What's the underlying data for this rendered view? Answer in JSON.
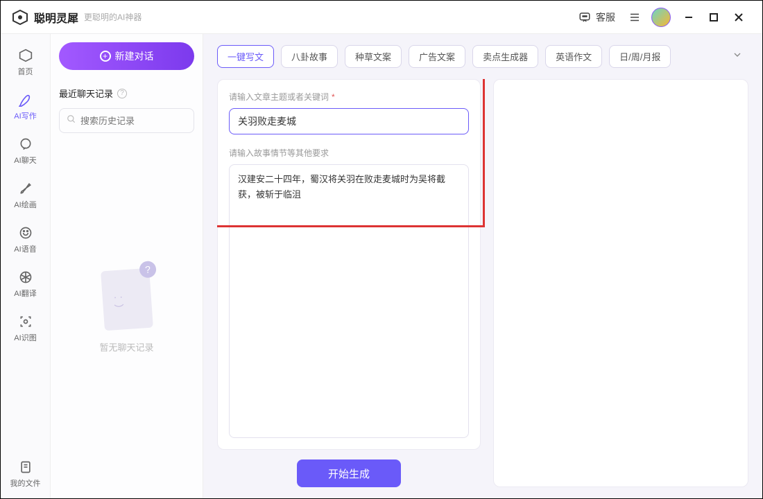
{
  "titlebar": {
    "app_name": "聪明灵犀",
    "app_sub": "更聪明的AI神器",
    "support_label": "客服"
  },
  "nav": {
    "items": [
      {
        "icon": "home",
        "label": "首页"
      },
      {
        "icon": "pen",
        "label": "AI写作"
      },
      {
        "icon": "chat",
        "label": "AI聊天"
      },
      {
        "icon": "brush",
        "label": "AI绘画"
      },
      {
        "icon": "voice",
        "label": "AI语音"
      },
      {
        "icon": "translate",
        "label": "AI翻译"
      },
      {
        "icon": "scan",
        "label": "AI识图"
      }
    ],
    "bottom": {
      "icon": "file",
      "label": "我的文件"
    }
  },
  "history": {
    "new_chat_label": "新建对话",
    "heading": "最近聊天记录",
    "search_placeholder": "搜索历史记录",
    "empty_text": "暂无聊天记录"
  },
  "tabs": [
    "一键写文",
    "八卦故事",
    "种草文案",
    "广告文案",
    "卖点生成器",
    "英语作文",
    "日/周/月报"
  ],
  "active_tab_index": 0,
  "form": {
    "topic_label": "请输入文章主题或者关键词",
    "topic_value": "关羽败走麦城",
    "details_label": "请输入故事情节等其他要求",
    "details_value": "汉建安二十四年，蜀汉将关羽在败走麦城时为吴将截获，被斩于临沮",
    "generate_label": "开始生成"
  }
}
